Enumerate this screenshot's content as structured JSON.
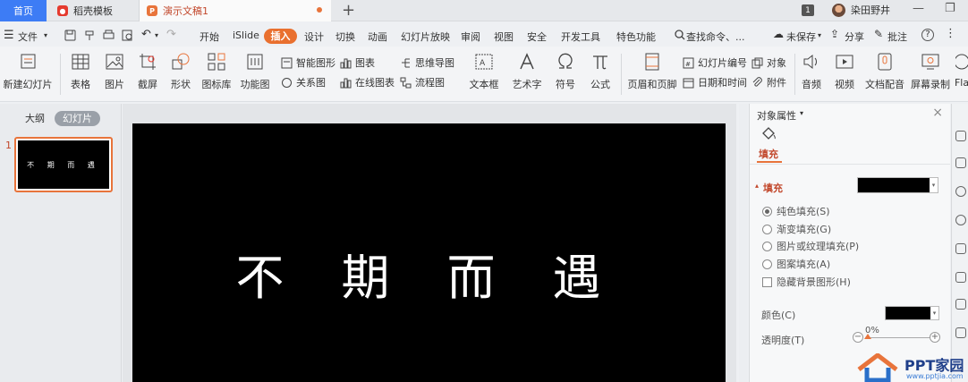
{
  "tabs": {
    "home": "首页",
    "template": "稻壳模板",
    "document": "演示文稿1",
    "new_tab_symbol": "+"
  },
  "titlebar": {
    "page_badge": "1",
    "username": "染田野井",
    "minimize": "—",
    "restore": "❐"
  },
  "menu": {
    "file": "文件",
    "items": [
      "开始",
      "iSlide",
      "插入",
      "设计",
      "切换",
      "动画",
      "幻灯片放映",
      "审阅",
      "视图",
      "安全",
      "开发工具",
      "特色功能"
    ],
    "active": "插入",
    "search": "查找命令、...",
    "unsaved": "未保存",
    "share": "分享",
    "comment": "批注",
    "help": "?"
  },
  "ribbon": {
    "new_slide": "新建幻灯片",
    "table": "表格",
    "picture": "图片",
    "screenshot": "截屏",
    "shape": "形状",
    "icon_lib": "图标库",
    "function_chart": "功能图",
    "smart_art": "智能图形",
    "chart": "图表",
    "mind_map": "思维导图",
    "relation": "关系图",
    "online_chart": "在线图表",
    "flowchart": "流程图",
    "textbox": "文本框",
    "art_text": "艺术字",
    "symbol": "符号",
    "formula": "公式",
    "header_footer": "页眉和页脚",
    "slide_number": "幻灯片编号",
    "object": "对象",
    "datetime": "日期和时间",
    "attachment": "附件",
    "audio": "音频",
    "video": "视频",
    "doc_dub": "文档配音",
    "screen_record": "屏幕录制",
    "flash_cut": "Fla"
  },
  "left_panel": {
    "outline_tab": "大纲",
    "slides_tab": "幻灯片",
    "slide_number": "1",
    "thumb_text": "不 期 而 遇"
  },
  "slide": {
    "title": "不期而遇"
  },
  "right_panel": {
    "title": "对象属性",
    "close": "×",
    "tab_fill": "填充",
    "section_fill": "填充",
    "fill_color": "#000000",
    "options": {
      "solid": "纯色填充(S)",
      "gradient": "渐变填充(G)",
      "picture": "图片或纹理填充(P)",
      "pattern": "图案填充(A)",
      "hide_bg": "隐藏背景图形(H)"
    },
    "selected_option": "solid",
    "color_label": "颜色(C)",
    "transparency_label": "透明度(T)",
    "transparency_value": "0%",
    "transparency_fraction": 0
  },
  "watermark": {
    "brand": "PPT家园",
    "site": "www.pptjia.com"
  },
  "colors": {
    "accent": "#e8743b",
    "home_tab": "#3d7cf5"
  }
}
